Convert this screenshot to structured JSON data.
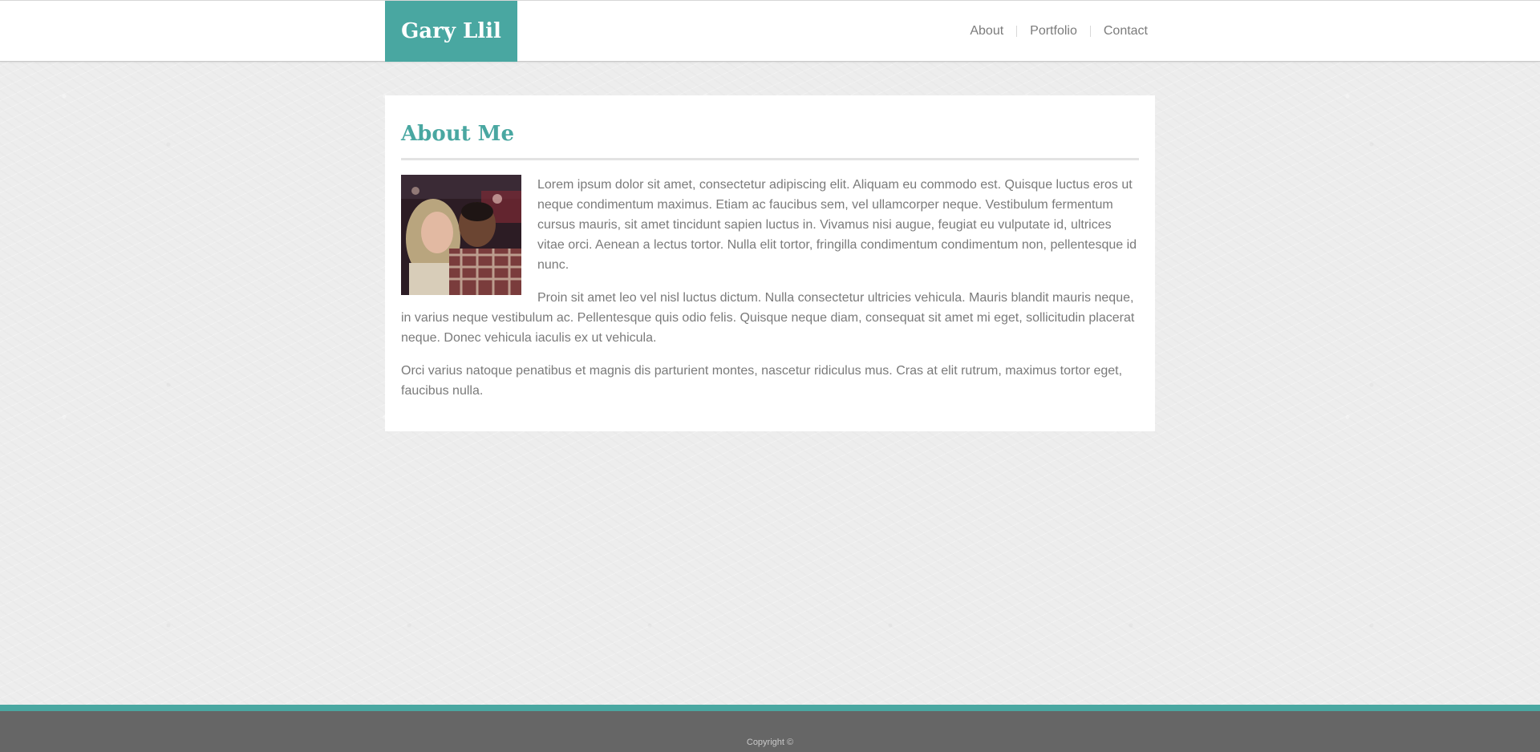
{
  "header": {
    "brand": "Gary Llil",
    "nav": [
      {
        "label": "About"
      },
      {
        "label": "Portfolio"
      },
      {
        "label": "Contact"
      }
    ]
  },
  "main": {
    "title": "About Me",
    "photo_icon": "profile-photo",
    "paragraphs": [
      "Lorem ipsum dolor sit amet, consectetur adipiscing elit. Aliquam eu commodo est. Quisque luctus eros ut neque condimentum maximus. Etiam ac faucibus sem, vel ullamcorper neque. Vestibulum fermentum cursus mauris, sit amet tincidunt sapien luctus in. Vivamus nisi augue, feugiat eu vulputate id, ultrices vitae orci. Aenean a lectus tortor. Nulla elit tortor, fringilla condimentum condimentum non, pellentesque id nunc.",
      "Proin sit amet leo vel nisl luctus dictum. Nulla consectetur ultricies vehicula. Mauris blandit mauris neque, in varius neque vestibulum ac. Pellentesque quis odio felis. Quisque neque diam, consequat sit amet mi eget, sollicitudin placerat neque. Donec vehicula iaculis ex ut vehicula.",
      "Orci varius natoque penatibus et magnis dis parturient montes, nascetur ridiculus mus. Cras at elit rutrum, maximus tortor eget, faucibus nulla."
    ]
  },
  "footer": {
    "copyright": "Copyright ©"
  },
  "colors": {
    "accent": "#49a7a1",
    "footer_bg": "#666666",
    "text": "#7a7a7a"
  }
}
